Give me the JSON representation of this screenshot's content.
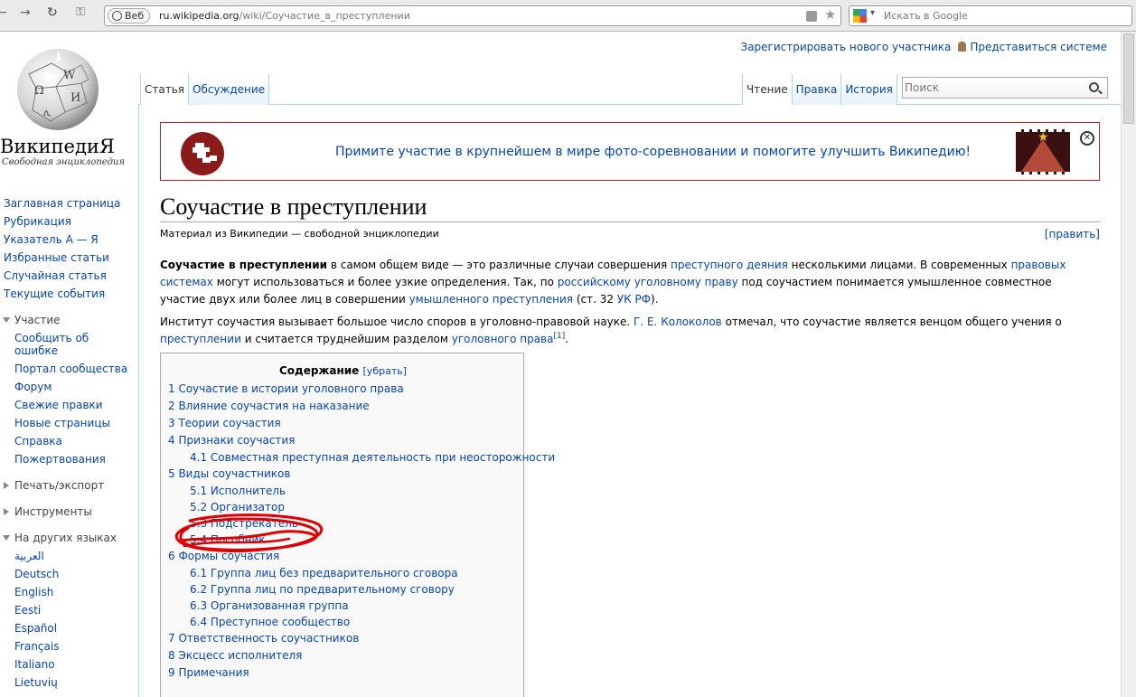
{
  "browser": {
    "web_chip": "Веб",
    "url_domain": "ru.wikipedia.org",
    "url_path": "/wiki/Соучастие_в_преступлении",
    "search_placeholder": "Искать в Google"
  },
  "personal": {
    "register": "Зарегистрировать нового участника",
    "login": "Представиться системе"
  },
  "logo": {
    "wordmark": "ВикипедиЯ",
    "tagline": "Свободная энциклопедия"
  },
  "nav": {
    "main": [
      "Заглавная страница",
      "Рубрикация",
      "Указатель А — Я",
      "Избранные статьи",
      "Случайная статья",
      "Текущие события"
    ],
    "participation": {
      "heading": "Участие",
      "items": [
        "Сообщить об ошибке",
        "Портал сообщества",
        "Форум",
        "Свежие правки",
        "Новые страницы",
        "Справка",
        "Пожертвования"
      ]
    },
    "print": "Печать/экспорт",
    "tools": "Инструменты",
    "languages": {
      "heading": "На других языках",
      "items": [
        "العربية",
        "Deutsch",
        "English",
        "Eesti",
        "Español",
        "Français",
        "Italiano",
        "Lietuvių"
      ]
    }
  },
  "tabs": {
    "left": [
      "Статья",
      "Обсуждение"
    ],
    "right": [
      "Чтение",
      "Правка",
      "История"
    ],
    "search_placeholder": "Поиск"
  },
  "banner": {
    "text": "Примите участие в крупнейшем в мире фото-соревновании и помогите улучшить Википедию!",
    "close": "✕"
  },
  "article": {
    "title": "Соучастие в преступлении",
    "from": "Материал из Википедии — свободной энциклопедии",
    "edit": "[править]",
    "p1": {
      "bold": "Соучастие в преступлении",
      "t1": " в самом общем виде — это различные случаи совершения ",
      "l1": "преступного деяния",
      "t2": " несколькими лицами. В современных ",
      "l2": "правовых системах",
      "t3": " могут использоваться и более узкие определения. Так, по ",
      "l3": "российскому уголовному праву",
      "t4": " под соучастием понимается умышленное совместное участие двух или более лиц в совершении ",
      "l4": "умышленного преступления",
      "t5": " (ст. 32 ",
      "l5": "УК РФ",
      "t6": ")."
    },
    "p2": {
      "t1": "Институт соучастия вызывает большое число споров в уголовно-правовой науке. ",
      "l1": "Г. Е. Колоколов",
      "t2": " отмечал, что соучастие является венцом общего учения о ",
      "l2": "преступлении",
      "t3": " и считается труднейшим разделом ",
      "l3": "уголовного права",
      "ref": "[1]",
      "t4": "."
    }
  },
  "toc": {
    "title": "Содержание",
    "hide": "[убрать]",
    "items": [
      {
        "label": "1 Соучастие в истории уголовного права",
        "level": 1
      },
      {
        "label": "2 Влияние соучастия на наказание",
        "level": 1
      },
      {
        "label": "3 Теории соучастия",
        "level": 1
      },
      {
        "label": "4 Признаки соучастия",
        "level": 1
      },
      {
        "label": "4.1 Совместная преступная деятельность при неосторожности",
        "level": 2
      },
      {
        "label": "5 Виды соучастников",
        "level": 1
      },
      {
        "label": "5.1 Исполнитель",
        "level": 2
      },
      {
        "label": "5.2 Организатор",
        "level": 2
      },
      {
        "label": "5.3 Подстрекатель",
        "level": 2
      },
      {
        "label": "5.4 Пособник",
        "level": 2
      },
      {
        "label": "6 Формы соучастия",
        "level": 1
      },
      {
        "label": "6.1 Группа лиц без предварительного сговора",
        "level": 2
      },
      {
        "label": "6.2 Группа лиц по предварительному сговору",
        "level": 2
      },
      {
        "label": "6.3 Организованная группа",
        "level": 2
      },
      {
        "label": "6.4 Преступное сообщество",
        "level": 2
      },
      {
        "label": "7 Ответственность соучастников",
        "level": 1
      },
      {
        "label": "8 Эксцесс исполнителя",
        "level": 1
      },
      {
        "label": "9 Примечания",
        "level": 1
      }
    ]
  },
  "colors": {
    "link": "#0645ad",
    "annotation": "#e00000",
    "banner_border": "#b32424"
  }
}
